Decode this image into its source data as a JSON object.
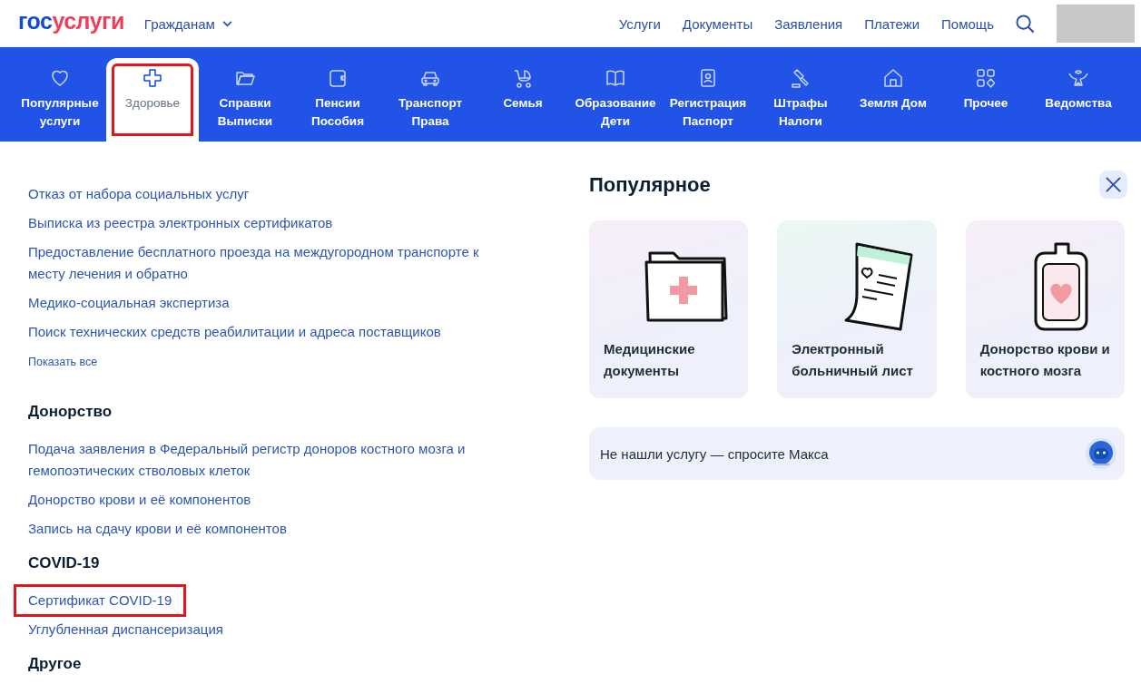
{
  "header": {
    "logo": [
      {
        "text": "гос",
        "color": "#0d4cd3"
      },
      {
        "text": "услуги",
        "color": "#ee3f58"
      }
    ],
    "audience": "Гражданам",
    "menu": [
      "Услуги",
      "Документы",
      "Заявления",
      "Платежи",
      "Помощь"
    ]
  },
  "nav": {
    "tabs": [
      {
        "lines": [
          "Популярные",
          "услуги"
        ],
        "selected": false,
        "highlighted": false
      },
      {
        "lines": [
          "Здоровье"
        ],
        "selected": true,
        "highlighted": true
      },
      {
        "lines": [
          "Справки",
          "Выписки"
        ],
        "selected": false,
        "highlighted": false
      },
      {
        "lines": [
          "Пенсии",
          "Пособия"
        ],
        "selected": false,
        "highlighted": false
      },
      {
        "lines": [
          "Транспорт",
          "Права"
        ],
        "selected": false,
        "highlighted": false
      },
      {
        "lines": [
          "Семья"
        ],
        "selected": false,
        "highlighted": false
      },
      {
        "lines": [
          "Образование",
          "Дети"
        ],
        "selected": false,
        "highlighted": false
      },
      {
        "lines": [
          "Регистрация",
          "Паспорт"
        ],
        "selected": false,
        "highlighted": false
      },
      {
        "lines": [
          "Штрафы",
          "Налоги"
        ],
        "selected": false,
        "highlighted": false
      },
      {
        "lines": [
          "Земля Дом"
        ],
        "selected": false,
        "highlighted": false
      },
      {
        "lines": [
          "Прочее"
        ],
        "selected": false,
        "highlighted": false
      },
      {
        "lines": [
          "Ведомства"
        ],
        "selected": false,
        "highlighted": false
      }
    ]
  },
  "services": {
    "groups": [
      {
        "links": [
          {
            "text": "Отказ от набора социальных услуг",
            "highlighted": false
          },
          {
            "text": "Выписка из реестра электронных сертификатов",
            "highlighted": false
          },
          {
            "text": "Предоставление бесплатного проезда на междугородном транспорте к месту лечения и обратно",
            "highlighted": false
          },
          {
            "text": "Медико-социальная экспертиза",
            "highlighted": false
          },
          {
            "text": "Поиск технических средств реабилитации и адреса поставщиков",
            "highlighted": false
          }
        ],
        "show_all": "Показать все"
      },
      {
        "heading": "Донорство",
        "links": [
          {
            "text": "Подача заявления в Федеральный регистр доноров костного мозга и гемопоэтических стволовых клеток",
            "highlighted": false
          },
          {
            "text": "Донорство крови и её компонентов",
            "highlighted": false
          },
          {
            "text": "Запись на сдачу крови и её компонентов",
            "highlighted": false
          }
        ]
      },
      {
        "heading": "COVID-19",
        "links": [
          {
            "text": "Сертификат COVID-19",
            "highlighted": true
          },
          {
            "text": "Углубленная диспансеризация",
            "highlighted": false
          }
        ]
      },
      {
        "heading": "Другое"
      }
    ]
  },
  "popular": {
    "title": "Популярное",
    "cards": [
      {
        "text": "Медицинские документы"
      },
      {
        "text": "Электронный больничный лист"
      },
      {
        "text": "Донорство крови и костного мозга"
      }
    ],
    "assistant": "Не нашли услугу — спросите Макса"
  }
}
